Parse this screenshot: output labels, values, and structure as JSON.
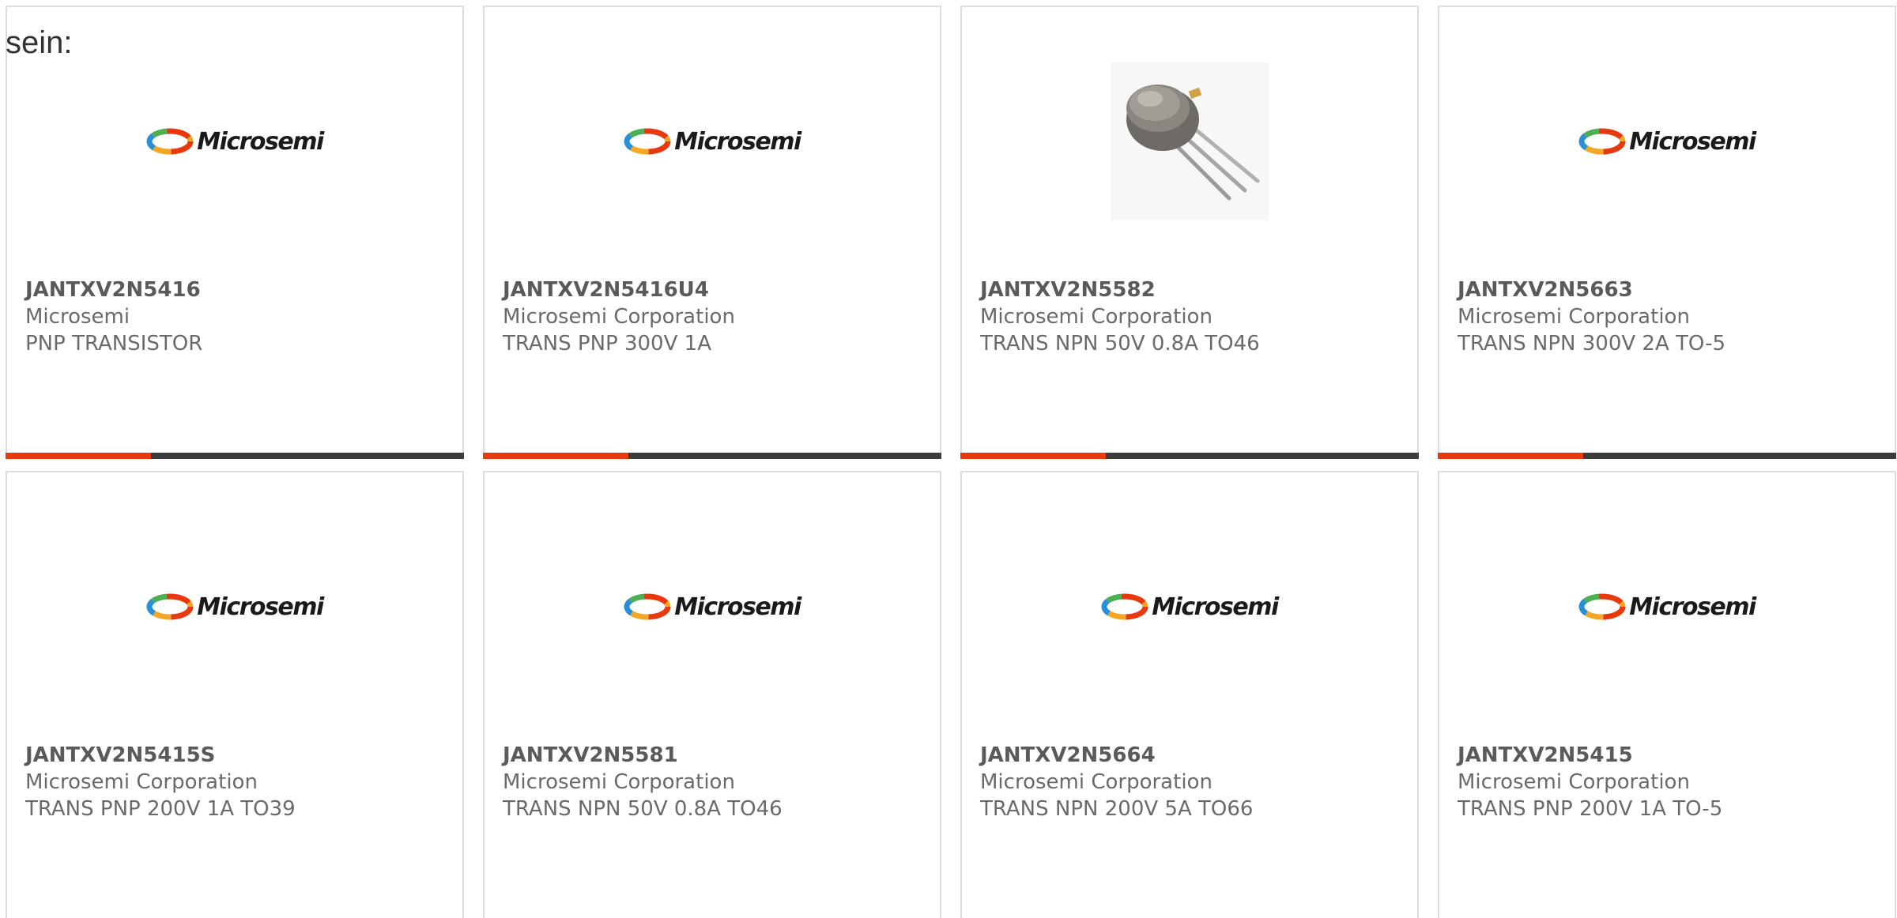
{
  "intro_text": "sein:",
  "accent_color": "#e8380d",
  "bar_color": "#3b3b3b",
  "products": [
    {
      "part_number": "JANTXV2N5416",
      "manufacturer": "Microsemi",
      "description": "PNP TRANSISTOR",
      "image": "microsemi-logo",
      "logo_text": "Microsemi"
    },
    {
      "part_number": "JANTXV2N5416U4",
      "manufacturer": "Microsemi Corporation",
      "description": "TRANS PNP 300V 1A",
      "image": "microsemi-logo",
      "logo_text": "Microsemi"
    },
    {
      "part_number": "JANTXV2N5582",
      "manufacturer": "Microsemi Corporation",
      "description": "TRANS NPN 50V 0.8A TO46",
      "image": "to46-transistor-photo"
    },
    {
      "part_number": "JANTXV2N5663",
      "manufacturer": "Microsemi Corporation",
      "description": "TRANS NPN 300V 2A TO-5",
      "image": "microsemi-logo",
      "logo_text": "Microsemi"
    },
    {
      "part_number": "JANTXV2N5415S",
      "manufacturer": "Microsemi Corporation",
      "description": "TRANS PNP 200V 1A TO39",
      "image": "microsemi-logo",
      "logo_text": "Microsemi"
    },
    {
      "part_number": "JANTXV2N5581",
      "manufacturer": "Microsemi Corporation",
      "description": "TRANS NPN 50V 0.8A TO46",
      "image": "microsemi-logo",
      "logo_text": "Microsemi"
    },
    {
      "part_number": "JANTXV2N5664",
      "manufacturer": "Microsemi Corporation",
      "description": "TRANS NPN 200V 5A TO66",
      "image": "microsemi-logo",
      "logo_text": "Microsemi"
    },
    {
      "part_number": "JANTXV2N5415",
      "manufacturer": "Microsemi Corporation",
      "description": "TRANS PNP 200V 1A TO-5",
      "image": "microsemi-logo",
      "logo_text": "Microsemi"
    }
  ]
}
